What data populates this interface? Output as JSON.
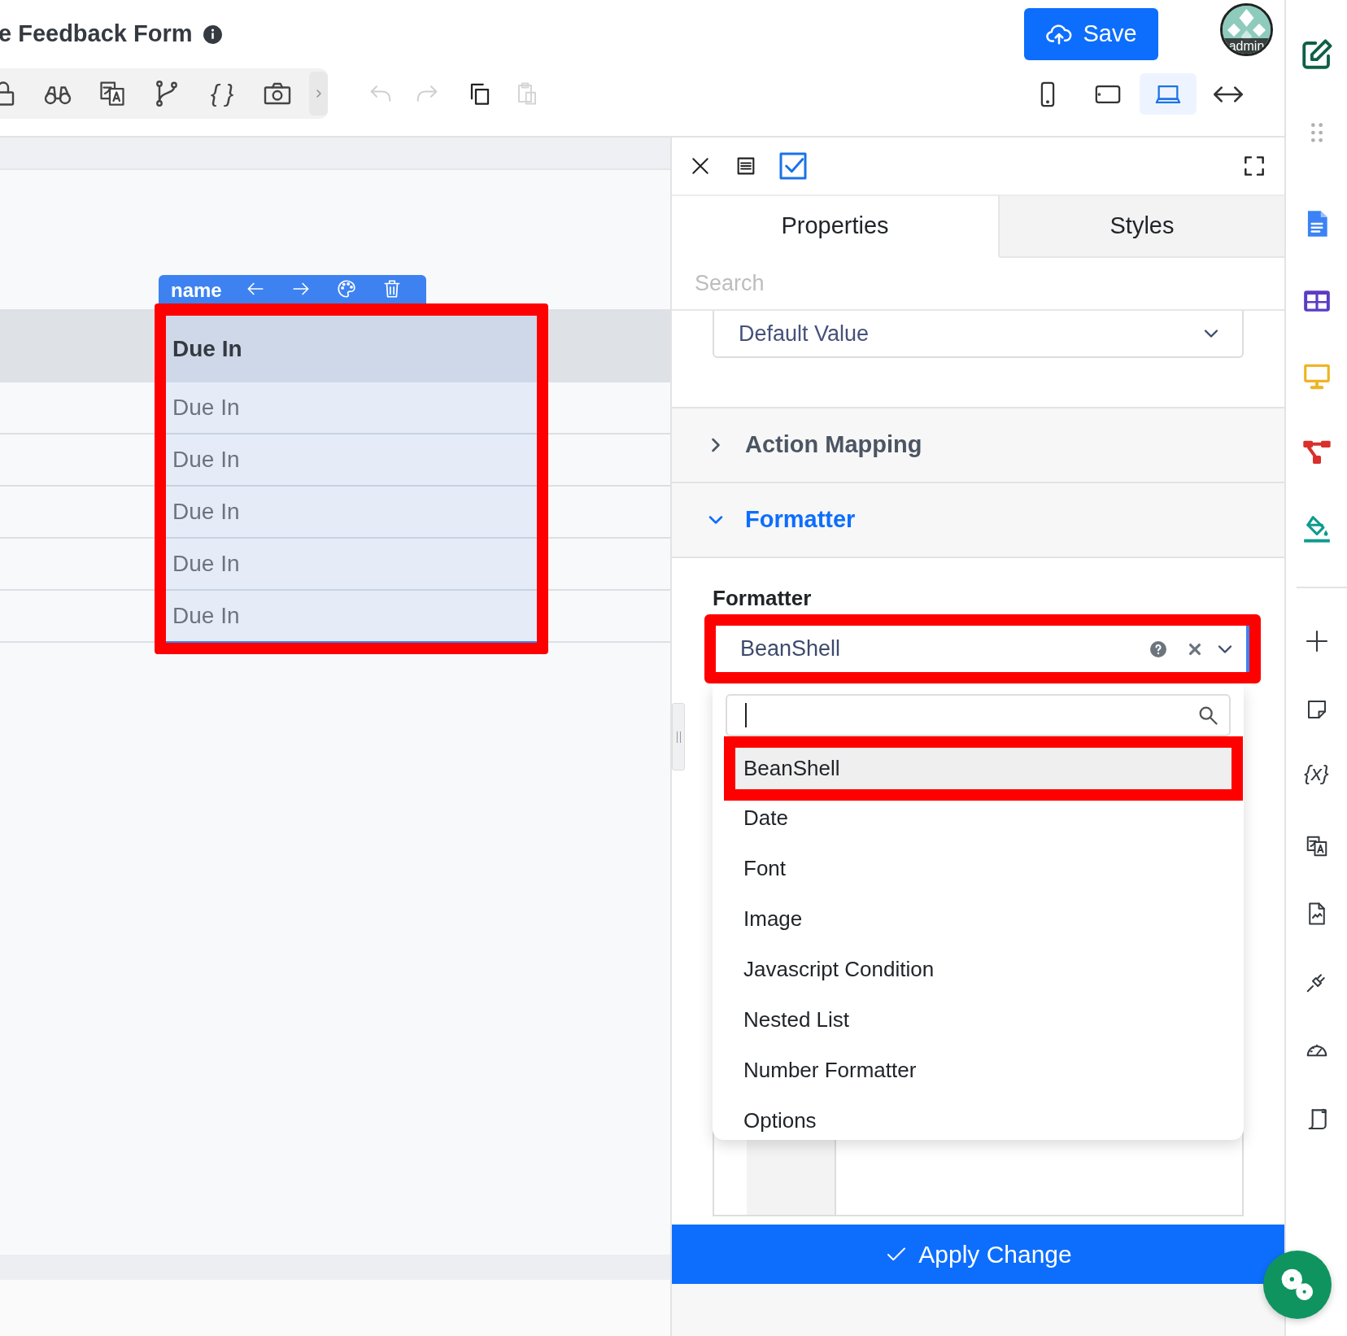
{
  "header": {
    "title": "e Feedback Form",
    "save_label": "Save",
    "avatar_label": "admin"
  },
  "toolbar": {
    "braces_glyph": "{ }"
  },
  "device_buttons": [
    {
      "kind": "phone",
      "selected": false
    },
    {
      "kind": "tablet",
      "selected": false
    },
    {
      "kind": "laptop",
      "selected": true
    },
    {
      "kind": "fluid",
      "selected": false
    }
  ],
  "canvas": {
    "column_toolbar_label": "name",
    "column": {
      "highlighted": true,
      "header": "Due In",
      "cells": [
        "Due In",
        "Due In",
        "Due In",
        "Due In",
        "Due In"
      ]
    }
  },
  "panel": {
    "tabs": [
      {
        "label": "Properties",
        "selected": true
      },
      {
        "label": "Styles",
        "selected": false
      }
    ],
    "search": {
      "placeholder": "Search"
    },
    "default_value_select": "Default Value",
    "sections": [
      {
        "title": "Action Mapping",
        "expanded": false
      },
      {
        "title": "Formatter",
        "expanded": true
      }
    ],
    "formatter": {
      "label": "Formatter",
      "value": "BeanShell",
      "highlighted": true,
      "options": [
        {
          "label": "BeanShell",
          "selected": true,
          "highlighted": true
        },
        {
          "label": "Date",
          "selected": false,
          "highlighted": false
        },
        {
          "label": "Font",
          "selected": false,
          "highlighted": false
        },
        {
          "label": "Image",
          "selected": false,
          "highlighted": false
        },
        {
          "label": "Javascript Condition",
          "selected": false,
          "highlighted": false
        },
        {
          "label": "Nested List",
          "selected": false,
          "highlighted": false
        },
        {
          "label": "Number Formatter",
          "selected": false,
          "highlighted": false
        },
        {
          "label": "Options",
          "selected": false,
          "highlighted": false
        }
      ]
    },
    "apply_label": "Apply Change"
  },
  "sidebar": {
    "variables_glyph": "{x}"
  }
}
